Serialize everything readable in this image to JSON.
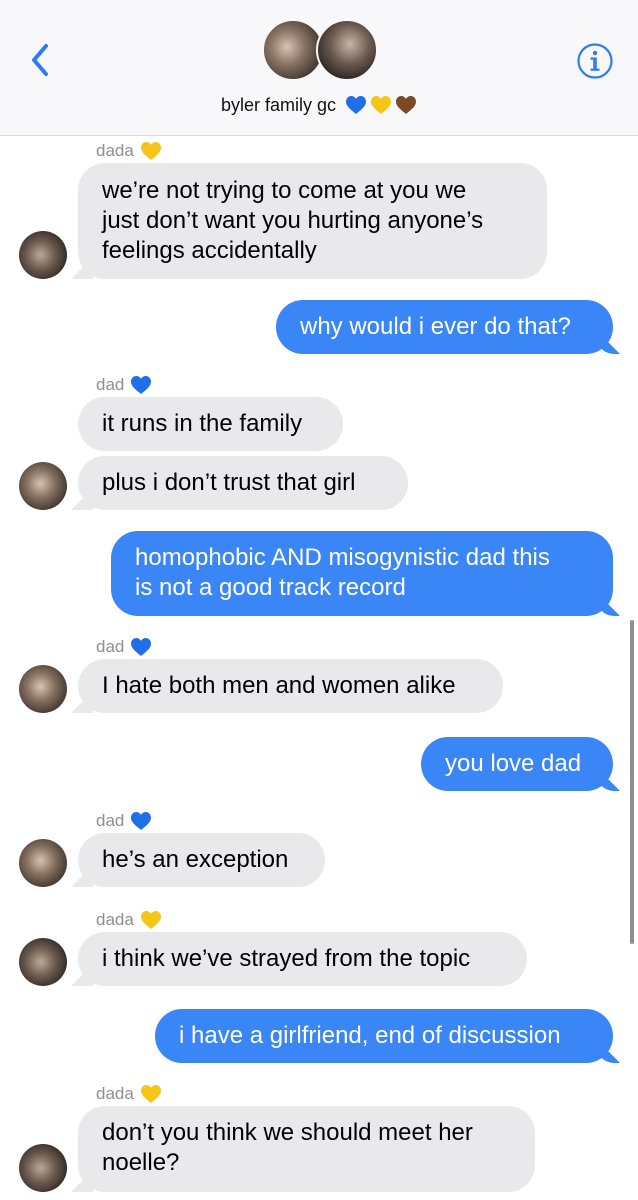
{
  "header": {
    "group_name": "byler family gc",
    "hearts": [
      "blue-heart",
      "yellow-heart",
      "brown-heart"
    ]
  },
  "colors": {
    "accent": "#3b86f7",
    "incoming_bubble": "#e9e9eb",
    "blue_heart": "#1f6fe8",
    "yellow_heart": "#f5c518",
    "brown_heart": "#7a4a26",
    "nav_icon": "#2f7bf5"
  },
  "messages": [
    {
      "direction": "in",
      "sender": "dada",
      "sender_heart": "yellow-heart",
      "lines": [
        "we’re not trying to come at you we",
        "just don’t want you hurting anyone’s",
        "feelings accidentally"
      ]
    },
    {
      "direction": "out",
      "lines": [
        "why would i ever do that?"
      ]
    },
    {
      "direction": "in",
      "sender": "dad",
      "sender_heart": "blue-heart",
      "lines": [
        "it runs in the family"
      ]
    },
    {
      "direction": "in",
      "lines": [
        "plus i don’t trust that girl"
      ]
    },
    {
      "direction": "out",
      "lines": [
        "homophobic AND misogynistic dad this",
        "is not a good track record"
      ]
    },
    {
      "direction": "in",
      "sender": "dad",
      "sender_heart": "blue-heart",
      "lines": [
        "I hate both men and women alike"
      ]
    },
    {
      "direction": "out",
      "lines": [
        "you love dad"
      ]
    },
    {
      "direction": "in",
      "sender": "dad",
      "sender_heart": "blue-heart",
      "lines": [
        "he’s an exception"
      ]
    },
    {
      "direction": "in",
      "sender": "dada",
      "sender_heart": "yellow-heart",
      "lines": [
        "i think we’ve strayed from the topic"
      ]
    },
    {
      "direction": "out",
      "lines": [
        "i have a girlfriend, end of discussion"
      ]
    },
    {
      "direction": "in",
      "sender": "dada",
      "sender_heart": "yellow-heart",
      "lines": [
        "don’t you think we should meet her",
        "noelle?"
      ]
    }
  ]
}
